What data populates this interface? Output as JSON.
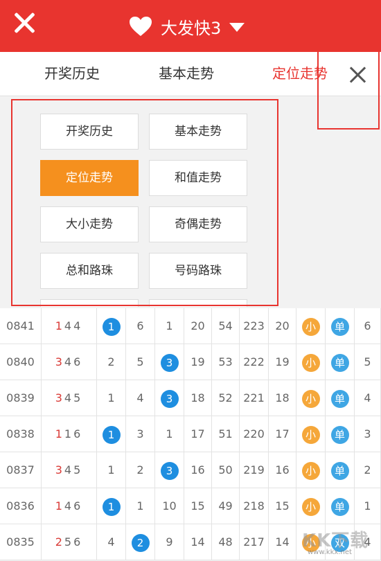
{
  "header": {
    "title": "大发快3"
  },
  "tabs": [
    "开奖历史",
    "基本走势",
    "定位走势"
  ],
  "menu": {
    "items": [
      "开奖历史",
      "基本走势",
      "定位走势",
      "和值走势",
      "大小走势",
      "奇偶走势",
      "总和路珠",
      "号码路珠"
    ],
    "active": "定位走势"
  },
  "rows": [
    {
      "issue": "0841",
      "d1": "1",
      "d2": "4",
      "d3": "4",
      "c1": "1",
      "c2": "6",
      "c3": "1",
      "c4": "20",
      "c5": "54",
      "c6": "223",
      "c7": "20",
      "size": "小",
      "parity": "单",
      "last": "6",
      "ball_col": 1
    },
    {
      "issue": "0840",
      "d1": "3",
      "d2": "4",
      "d3": "6",
      "c1": "2",
      "c2": "5",
      "c3": "3",
      "c4": "19",
      "c5": "53",
      "c6": "222",
      "c7": "19",
      "size": "小",
      "parity": "单",
      "last": "5",
      "ball_col": 3
    },
    {
      "issue": "0839",
      "d1": "3",
      "d2": "4",
      "d3": "5",
      "c1": "1",
      "c2": "4",
      "c3": "3",
      "c4": "18",
      "c5": "52",
      "c6": "221",
      "c7": "18",
      "size": "小",
      "parity": "单",
      "last": "4",
      "ball_col": 3
    },
    {
      "issue": "0838",
      "d1": "1",
      "d2": "1",
      "d3": "6",
      "c1": "1",
      "c2": "3",
      "c3": "1",
      "c4": "17",
      "c5": "51",
      "c6": "220",
      "c7": "17",
      "size": "小",
      "parity": "单",
      "last": "3",
      "ball_col": 1
    },
    {
      "issue": "0837",
      "d1": "3",
      "d2": "4",
      "d3": "5",
      "c1": "1",
      "c2": "2",
      "c3": "3",
      "c4": "16",
      "c5": "50",
      "c6": "219",
      "c7": "16",
      "size": "小",
      "parity": "单",
      "last": "2",
      "ball_col": 3
    },
    {
      "issue": "0836",
      "d1": "1",
      "d2": "4",
      "d3": "6",
      "c1": "1",
      "c2": "1",
      "c3": "10",
      "c4": "15",
      "c5": "49",
      "c6": "218",
      "c7": "15",
      "size": "小",
      "parity": "单",
      "last": "1",
      "ball_col": 1
    },
    {
      "issue": "0835",
      "d1": "2",
      "d2": "5",
      "d3": "6",
      "c1": "4",
      "c2": "2",
      "c3": "9",
      "c4": "14",
      "c5": "48",
      "c6": "217",
      "c7": "14",
      "size": "小",
      "parity": "双",
      "last": "4",
      "ball_col": 2
    }
  ],
  "watermark": {
    "main": "KK下载",
    "sub": "www.kkx.net"
  },
  "colors": {
    "header": "#e8342f",
    "active": "#f5901e",
    "ball_blue": "#1e8ee0"
  }
}
